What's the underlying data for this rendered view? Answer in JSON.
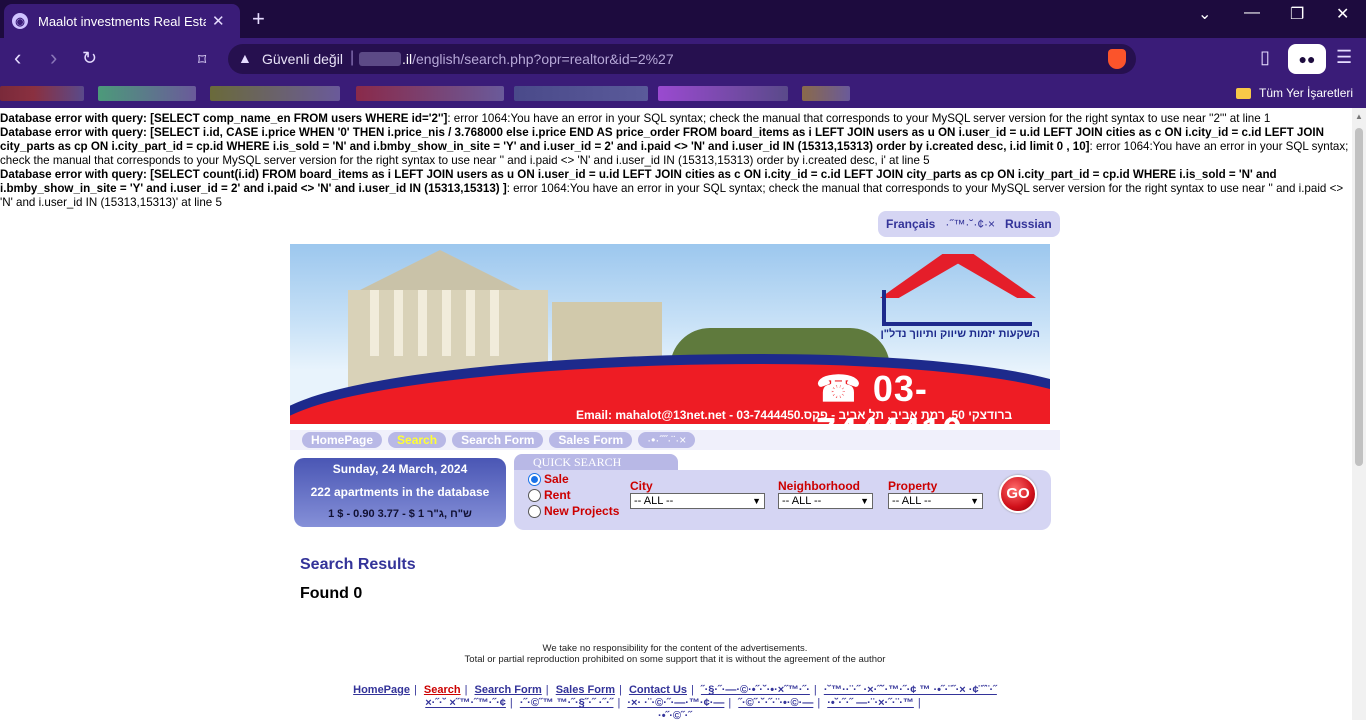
{
  "browser": {
    "tab_title": "Maalot investments Real Estate I",
    "tab_close": "✕",
    "new_tab": "+",
    "security_label": "Güvenli değil",
    "url_host": ".il",
    "url_path": "/english/search.php?opr=realtor&id=2%27",
    "bookmarks_folder": "Tüm Yer İşaretleri",
    "window_controls": [
      "⌄",
      "—",
      "❐",
      "✕"
    ]
  },
  "errors": [
    {
      "prefix": "Database error with query: [SELECT comp_name_en FROM users WHERE id='2'']",
      "message": ": error 1064:You have an error in your SQL syntax; check the manual that corresponds to your MySQL server version for the right syntax to use near ''2''' at line 1"
    },
    {
      "prefix": "Database error with query: [SELECT i.id, CASE i.price WHEN '0' THEN i.price_nis / 3.768000 else i.price END AS price_order FROM board_items as i LEFT JOIN users as u ON i.user_id = u.id LEFT JOIN cities as c ON i.city_id = c.id LEFT JOIN city_parts as cp ON i.city_part_id = cp.id WHERE i.is_sold = 'N' and i.bmby_show_in_site = 'Y' and i.user_id = 2' and i.paid <> 'N' and i.user_id IN (15313,15313) order by i.created desc, i.id limit 0 , 10]",
      "message": ": error 1064:You have an error in your SQL syntax; check the manual that corresponds to your MySQL server version for the right syntax to use near '' and i.paid <> 'N' and i.user_id IN (15313,15313) order by i.created desc, i' at line 5"
    },
    {
      "prefix": "Database error with query: [SELECT count(i.id) FROM board_items as i LEFT JOIN users as u ON i.user_id = u.id LEFT JOIN cities as c ON i.city_id = c.id LEFT JOIN city_parts as cp ON i.city_part_id = cp.id WHERE i.is_sold = 'N' and i.bmby_show_in_site = 'Y' and i.user_id = 2' and i.paid <> 'N' and i.user_id IN (15313,15313) ]",
      "message": ": error 1064:You have an error in your SQL syntax; check the manual that corresponds to your MySQL server version for the right syntax to use near '' and i.paid <> 'N' and i.user_id IN (15313,15313)' at line 5"
    }
  ],
  "languages": [
    "Français",
    "·˝™·˘·¢·×",
    "Russian"
  ],
  "banner": {
    "logo_text": "השקעות יזמות שיווק ותיווך נדל\"ן",
    "phone": "☎ 03-7444410",
    "email_line": "Email: mahalot@13net.net - 03-7444450.ברודצקי 50, רמת אביב, תל אביב - פקס"
  },
  "menu": [
    {
      "label": "HomePage",
      "active": false
    },
    {
      "label": "Search",
      "active": true
    },
    {
      "label": "Search Form",
      "active": false
    },
    {
      "label": "Sales Form",
      "active": false
    },
    {
      "label": "·•·˝˝·¨·×",
      "active": false
    }
  ],
  "info": {
    "date": "Sunday, 24 March, 2024",
    "count": "222 apartments in the database",
    "rate": "1 $ - 0.90 3.77 - $ 1 ש\"ח ,ג\"ר"
  },
  "quick_search": {
    "title": "QUICK SEARCH",
    "radio_options": [
      {
        "label": "Sale",
        "checked": true
      },
      {
        "label": "Rent",
        "checked": false
      },
      {
        "label": "New Projects",
        "checked": false
      }
    ],
    "city_label": "City",
    "city_value": "-- ALL --",
    "neighborhood_label": "Neighborhood",
    "neighborhood_value": "-- ALL --",
    "property_label": "Property",
    "property_value": "-- ALL --",
    "go_label": "GO"
  },
  "results": {
    "title": "Search Results",
    "found": "Found 0"
  },
  "disclaimer": [
    "We take no responsibility for the content of the advertisements.",
    "Total or partial reproduction prohibited on some support that it is without the agreement of the author"
  ],
  "footer": {
    "links": [
      "HomePage",
      "Search",
      "Search Form",
      "Sales Form",
      "Contact Us"
    ],
    "garbled_1": "˝·§·˝·—·©·•˝·˘·•·×˝™·˝·",
    "garbled_2": "·˘™··¨·˝ ·×·˝˘·™·˝·¢ ™ ·•˝·¨˝·× ·¢¨˝¨·˝",
    "line2": [
      "×·˝·˘ ×˝™·˝™·˝·¢",
      "·˝·©˝™ ™·˝·§˝·˝ ·˝·˝",
      "·×· ·¨·©·˝·—·™·¢·—",
      "˝·©˝·˘·˝·¨·•·©·—",
      "·•˘·˝·˝ —·¨·×·˝·¨·™"
    ],
    "garbled_3": "·•˝·©˝·˝"
  }
}
